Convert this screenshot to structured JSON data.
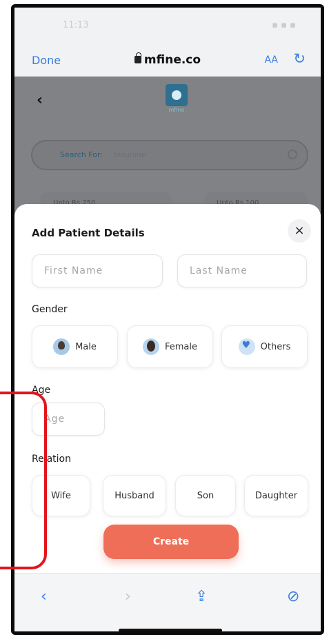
{
  "status_bar": {
    "time": "11:13",
    "indicators": "▪ ▪ ▪"
  },
  "browser": {
    "done_label": "Done",
    "url": "mfine.co",
    "text_size_label": "AA",
    "reload_icon": "reload-icon"
  },
  "page": {
    "back_icon": "back-arrow-icon",
    "logo_text": "mfine",
    "search_label": "Search For:",
    "search_placeholder": "Insulone",
    "chips": [
      "Upto Rs 250",
      "Upto Rs 100"
    ]
  },
  "sheet": {
    "title": "Add Patient Details",
    "close_label": "×",
    "first_name_placeholder": "First Name",
    "last_name_placeholder": "Last Name",
    "gender_label": "Gender",
    "gender_options": [
      "Male",
      "Female",
      "Others"
    ],
    "age_label": "Age",
    "age_placeholder": "Age",
    "relation_label": "Relation",
    "relation_options": [
      "Wife",
      "Husband",
      "Son",
      "Daughter"
    ],
    "create_label": "Create"
  },
  "toolbar": {
    "back": "‹",
    "forward": "›",
    "share": "⇪",
    "compass": "⊘"
  },
  "colors": {
    "accent": "#3a7de0",
    "create_button": "#ef6e58",
    "annotation": "#e4141b"
  }
}
